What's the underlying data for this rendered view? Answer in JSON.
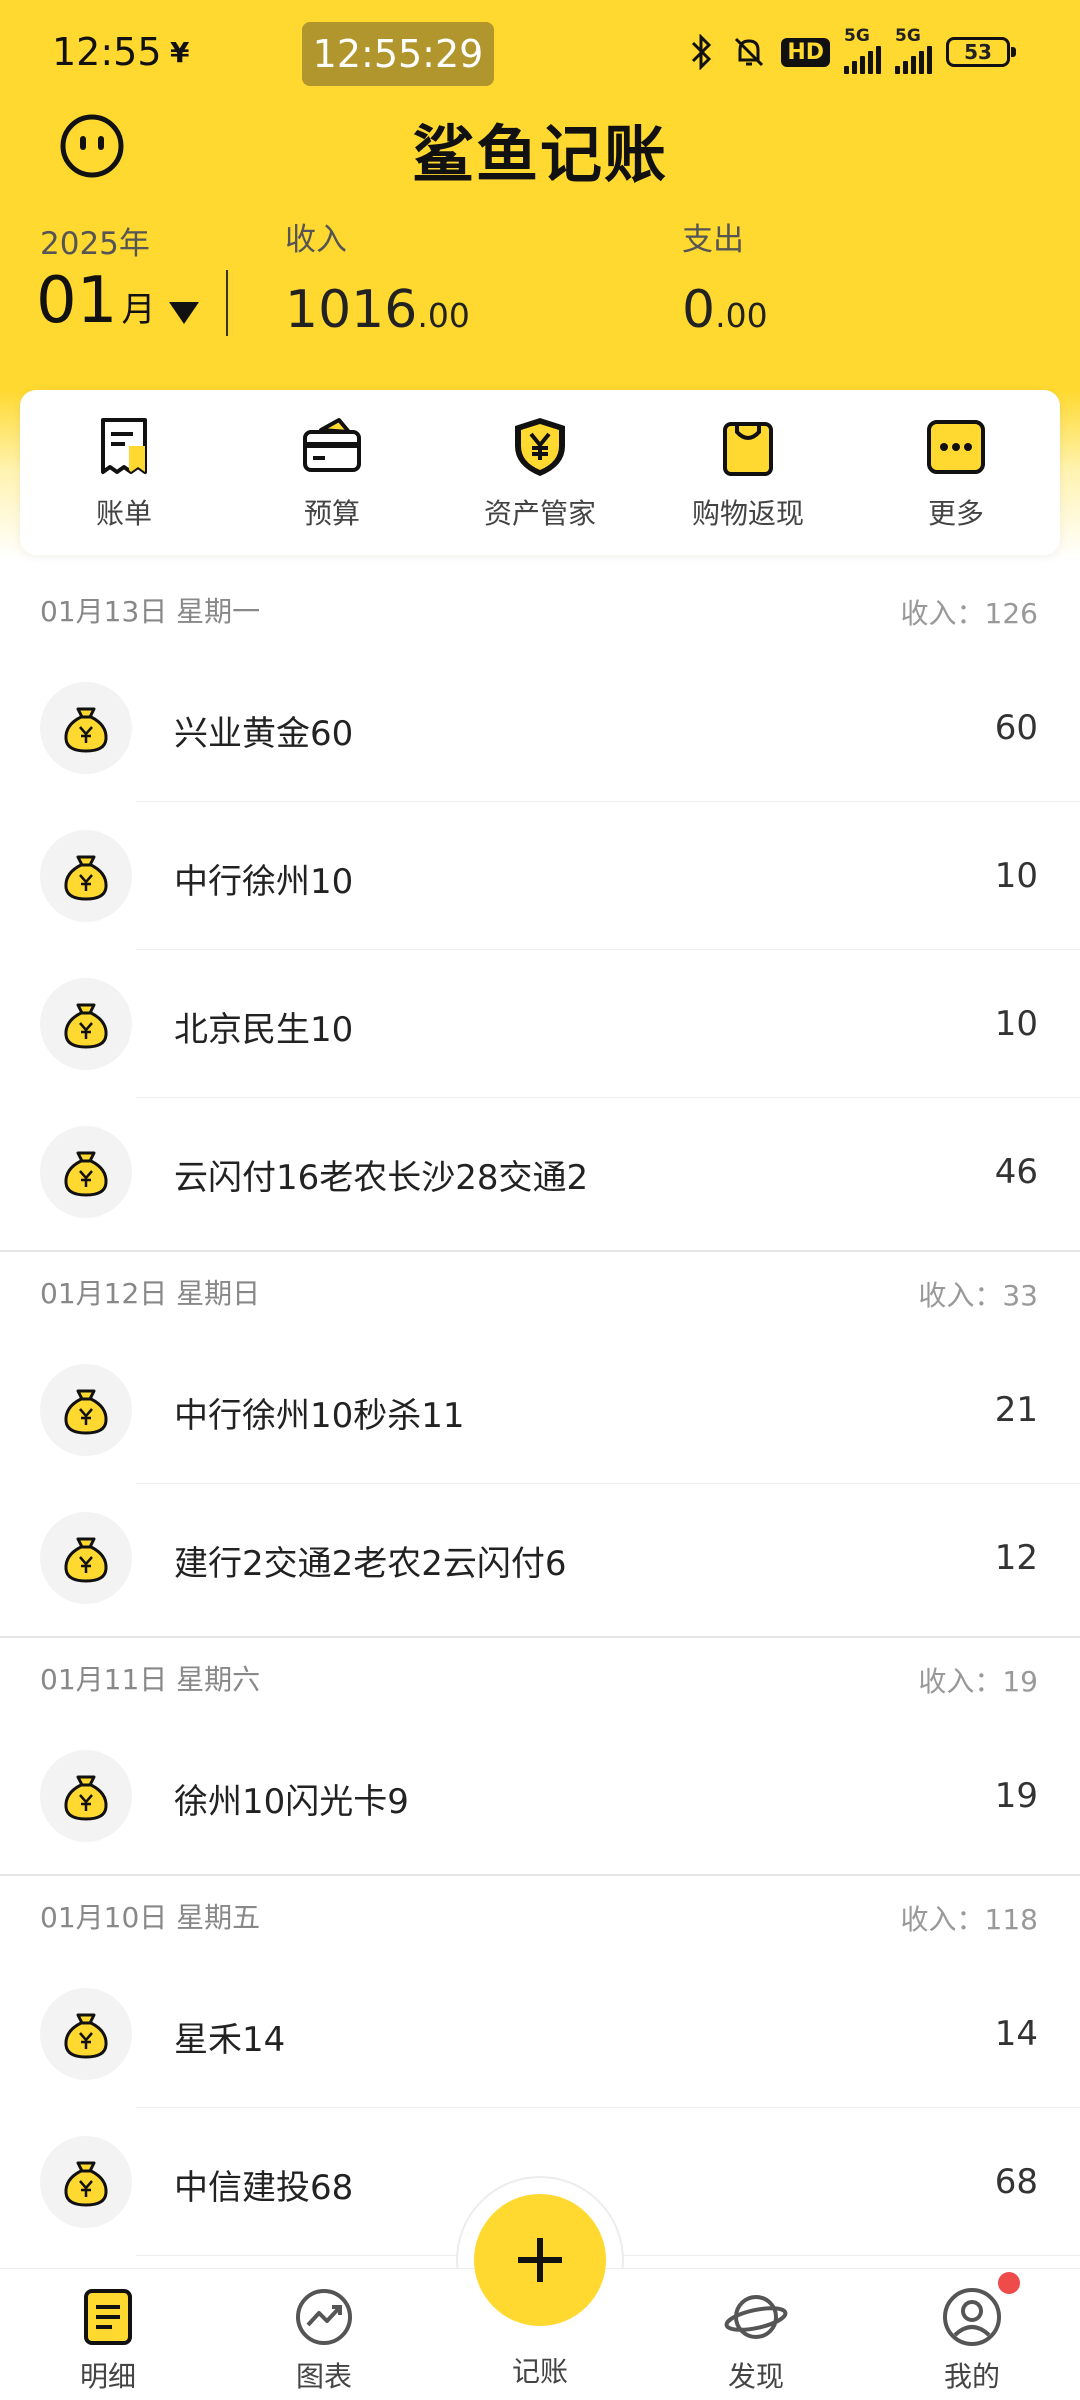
{
  "status_bar": {
    "time": "12:55",
    "extra_icon": "¥",
    "clock_pill": "12:55:29",
    "hd_label": "HD",
    "network_1": "5G",
    "network_2": "5G",
    "battery": "53"
  },
  "app": {
    "title": "鲨鱼记账",
    "avatar_icon": "smiley-face-icon"
  },
  "summary": {
    "year": "2025年",
    "month": "01",
    "month_unit": "月",
    "income_label": "收入",
    "income_int": "1016",
    "income_dec": ".00",
    "expense_label": "支出",
    "expense_int": "0",
    "expense_dec": ".00"
  },
  "quick_menu": [
    {
      "label": "账单",
      "icon": "bill-icon"
    },
    {
      "label": "预算",
      "icon": "wallet-icon"
    },
    {
      "label": "资产管家",
      "icon": "shield-yen-icon"
    },
    {
      "label": "购物返现",
      "icon": "shopping-bag-icon"
    },
    {
      "label": "更多",
      "icon": "more-icon"
    }
  ],
  "days": [
    {
      "date": "01月13日 星期一",
      "total": "收入：126",
      "items": [
        {
          "title": "兴业黄金60",
          "amount": "60"
        },
        {
          "title": "中行徐州10",
          "amount": "10"
        },
        {
          "title": "北京民生10",
          "amount": "10"
        },
        {
          "title": "云闪付16老农长沙28交通2",
          "amount": "46"
        }
      ]
    },
    {
      "date": "01月12日 星期日",
      "total": "收入：33",
      "items": [
        {
          "title": "中行徐州10秒杀11",
          "amount": "21"
        },
        {
          "title": "建行2交通2老农2云闪付6",
          "amount": "12"
        }
      ]
    },
    {
      "date": "01月11日 星期六",
      "total": "收入：19",
      "items": [
        {
          "title": "徐州10闪光卡9",
          "amount": "19"
        }
      ]
    },
    {
      "date": "01月10日 星期五",
      "total": "收入：118",
      "items": [
        {
          "title": "星禾14",
          "amount": "14"
        },
        {
          "title": "中信建投68",
          "amount": "68"
        }
      ]
    }
  ],
  "tabbar": {
    "details": "明细",
    "charts": "图表",
    "record": "记账",
    "discover": "发现",
    "mine": "我的"
  },
  "colors": {
    "accent": "#FFD92F",
    "badge_red": "#F04B4B"
  }
}
